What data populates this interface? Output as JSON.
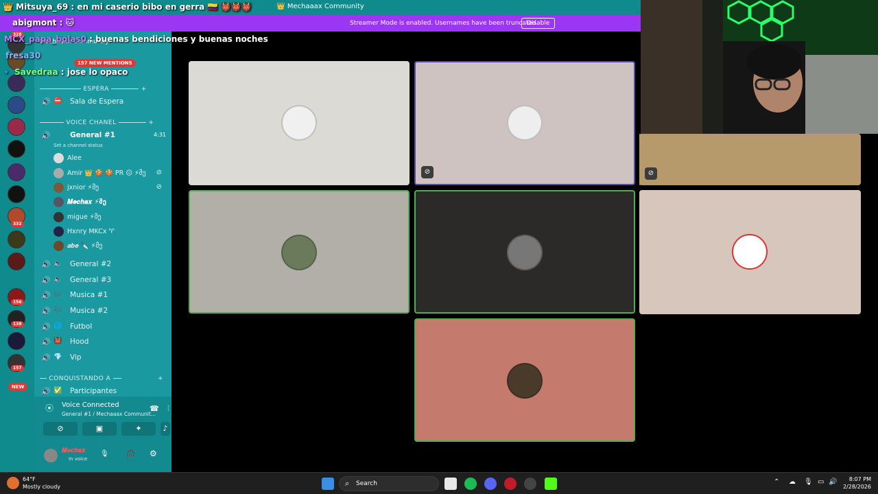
{
  "window": {
    "title": "Mechaaax Community"
  },
  "streamer_mode": {
    "message": "Streamer Mode is enabled. Usernames have been truncated.",
    "button_label": "Disable"
  },
  "chat_overlay": [
    {
      "user": "Mitsuya_69",
      "message": "en mi caserio bibo en gerra",
      "color": "#ffffff"
    },
    {
      "user": "abigmont",
      "message": "",
      "color": "#ffffff"
    },
    {
      "user": "MCX_papa_bolas0",
      "message": "buenas bendiciones y buenas noches",
      "color": "#b77cff"
    },
    {
      "user": "fresa30",
      "message": "",
      "color": "#7fb5ff"
    },
    {
      "user": "Savedraa",
      "message": "jose lo opaco",
      "color": "#7fff7f"
    }
  ],
  "mentions_badge": "157 NEW MENTIONS",
  "server_badges": [
    "328",
    "332",
    "156",
    "138",
    "157",
    "NEW"
  ],
  "sidebar": {
    "server_name": "Mechaaax Community",
    "categories": [
      {
        "label": "ESPERA"
      },
      {
        "label": "VOICE CHANEL"
      },
      {
        "label": "CONQUISTANDO A"
      }
    ],
    "channels": [
      {
        "label": "Sala de Espera"
      },
      {
        "label": "General #1",
        "time": "4:31",
        "status": "Set a channel status"
      },
      {
        "label": "General #2"
      },
      {
        "label": "General #3"
      },
      {
        "label": "Musica #1"
      },
      {
        "label": "Musica #2"
      },
      {
        "label": "Futbol"
      },
      {
        "label": "Hood"
      },
      {
        "label": "Vip"
      },
      {
        "label": "Participantes"
      }
    ],
    "users": [
      {
        "name": "Alee"
      },
      {
        "name": "Amir 👑 🍪 🍪 PR 😐 ⚡მე"
      },
      {
        "name": "jxnior ⚡მე"
      },
      {
        "name": "𝑴𝒆𝒄𝒉𝒂𝒙 ⚡მე"
      },
      {
        "name": "migue ⚡მე"
      },
      {
        "name": "Hxnry MKCx ♈"
      },
      {
        "name": "𝒂𝒃𝒆 🔪 ⚡მე"
      }
    ]
  },
  "voice_panel": {
    "status": "Voice Connected",
    "channel": "General #1 / Mechaaax Communit...",
    "username": "𝑴𝒆𝒄𝒉𝒂𝒙",
    "user_status": "In voice"
  },
  "taskbar": {
    "temperature": "64°F",
    "weather": "Mostly cloudy",
    "search_label": "Search",
    "time": "8:07 PM",
    "date": "2/28/2026"
  },
  "colors": {
    "titlebar": "#0f8b8d",
    "sidebar": "#1a9aa0",
    "streamer_bar": "#9b36f2",
    "speaking_border": "#4caf50"
  }
}
